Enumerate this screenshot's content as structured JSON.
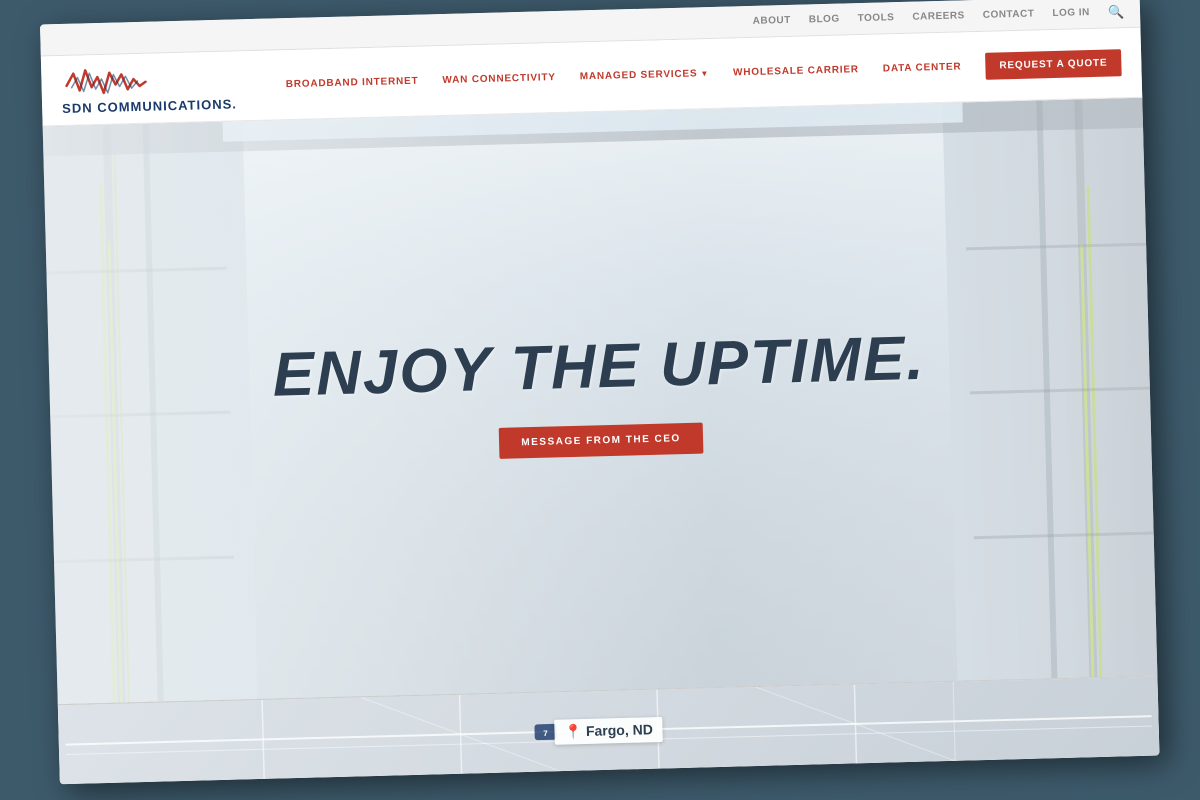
{
  "utility_bar": {
    "links": [
      {
        "label": "ABOUT",
        "name": "about-link"
      },
      {
        "label": "BLOG",
        "name": "blog-link"
      },
      {
        "label": "TOOLS",
        "name": "tools-link"
      },
      {
        "label": "CAREERS",
        "name": "careers-link"
      },
      {
        "label": "CONTACT",
        "name": "contact-link"
      },
      {
        "label": "LOG IN",
        "name": "login-link"
      }
    ],
    "search_title": "Search"
  },
  "nav": {
    "logo_text": "SDN COMMUNICATIONS.",
    "links": [
      {
        "label": "BROADBAND INTERNET",
        "name": "broadband-internet-link"
      },
      {
        "label": "WAN CONNECTIVITY",
        "name": "wan-connectivity-link"
      },
      {
        "label": "MANAGED SERVICES",
        "name": "managed-services-link",
        "has_dropdown": true
      },
      {
        "label": "WHOLESALE CARRIER",
        "name": "wholesale-carrier-link"
      },
      {
        "label": "DATA CENTER",
        "name": "data-center-link"
      }
    ],
    "cta_label": "REQUEST A QUOTE",
    "cta_name": "request-quote-button"
  },
  "hero": {
    "headline": "ENJOY THE UPTIME.",
    "cta_label": "MESSAGE FROM THE CEO",
    "cta_name": "ceo-message-button"
  },
  "map": {
    "city": "Fargo, ND"
  }
}
